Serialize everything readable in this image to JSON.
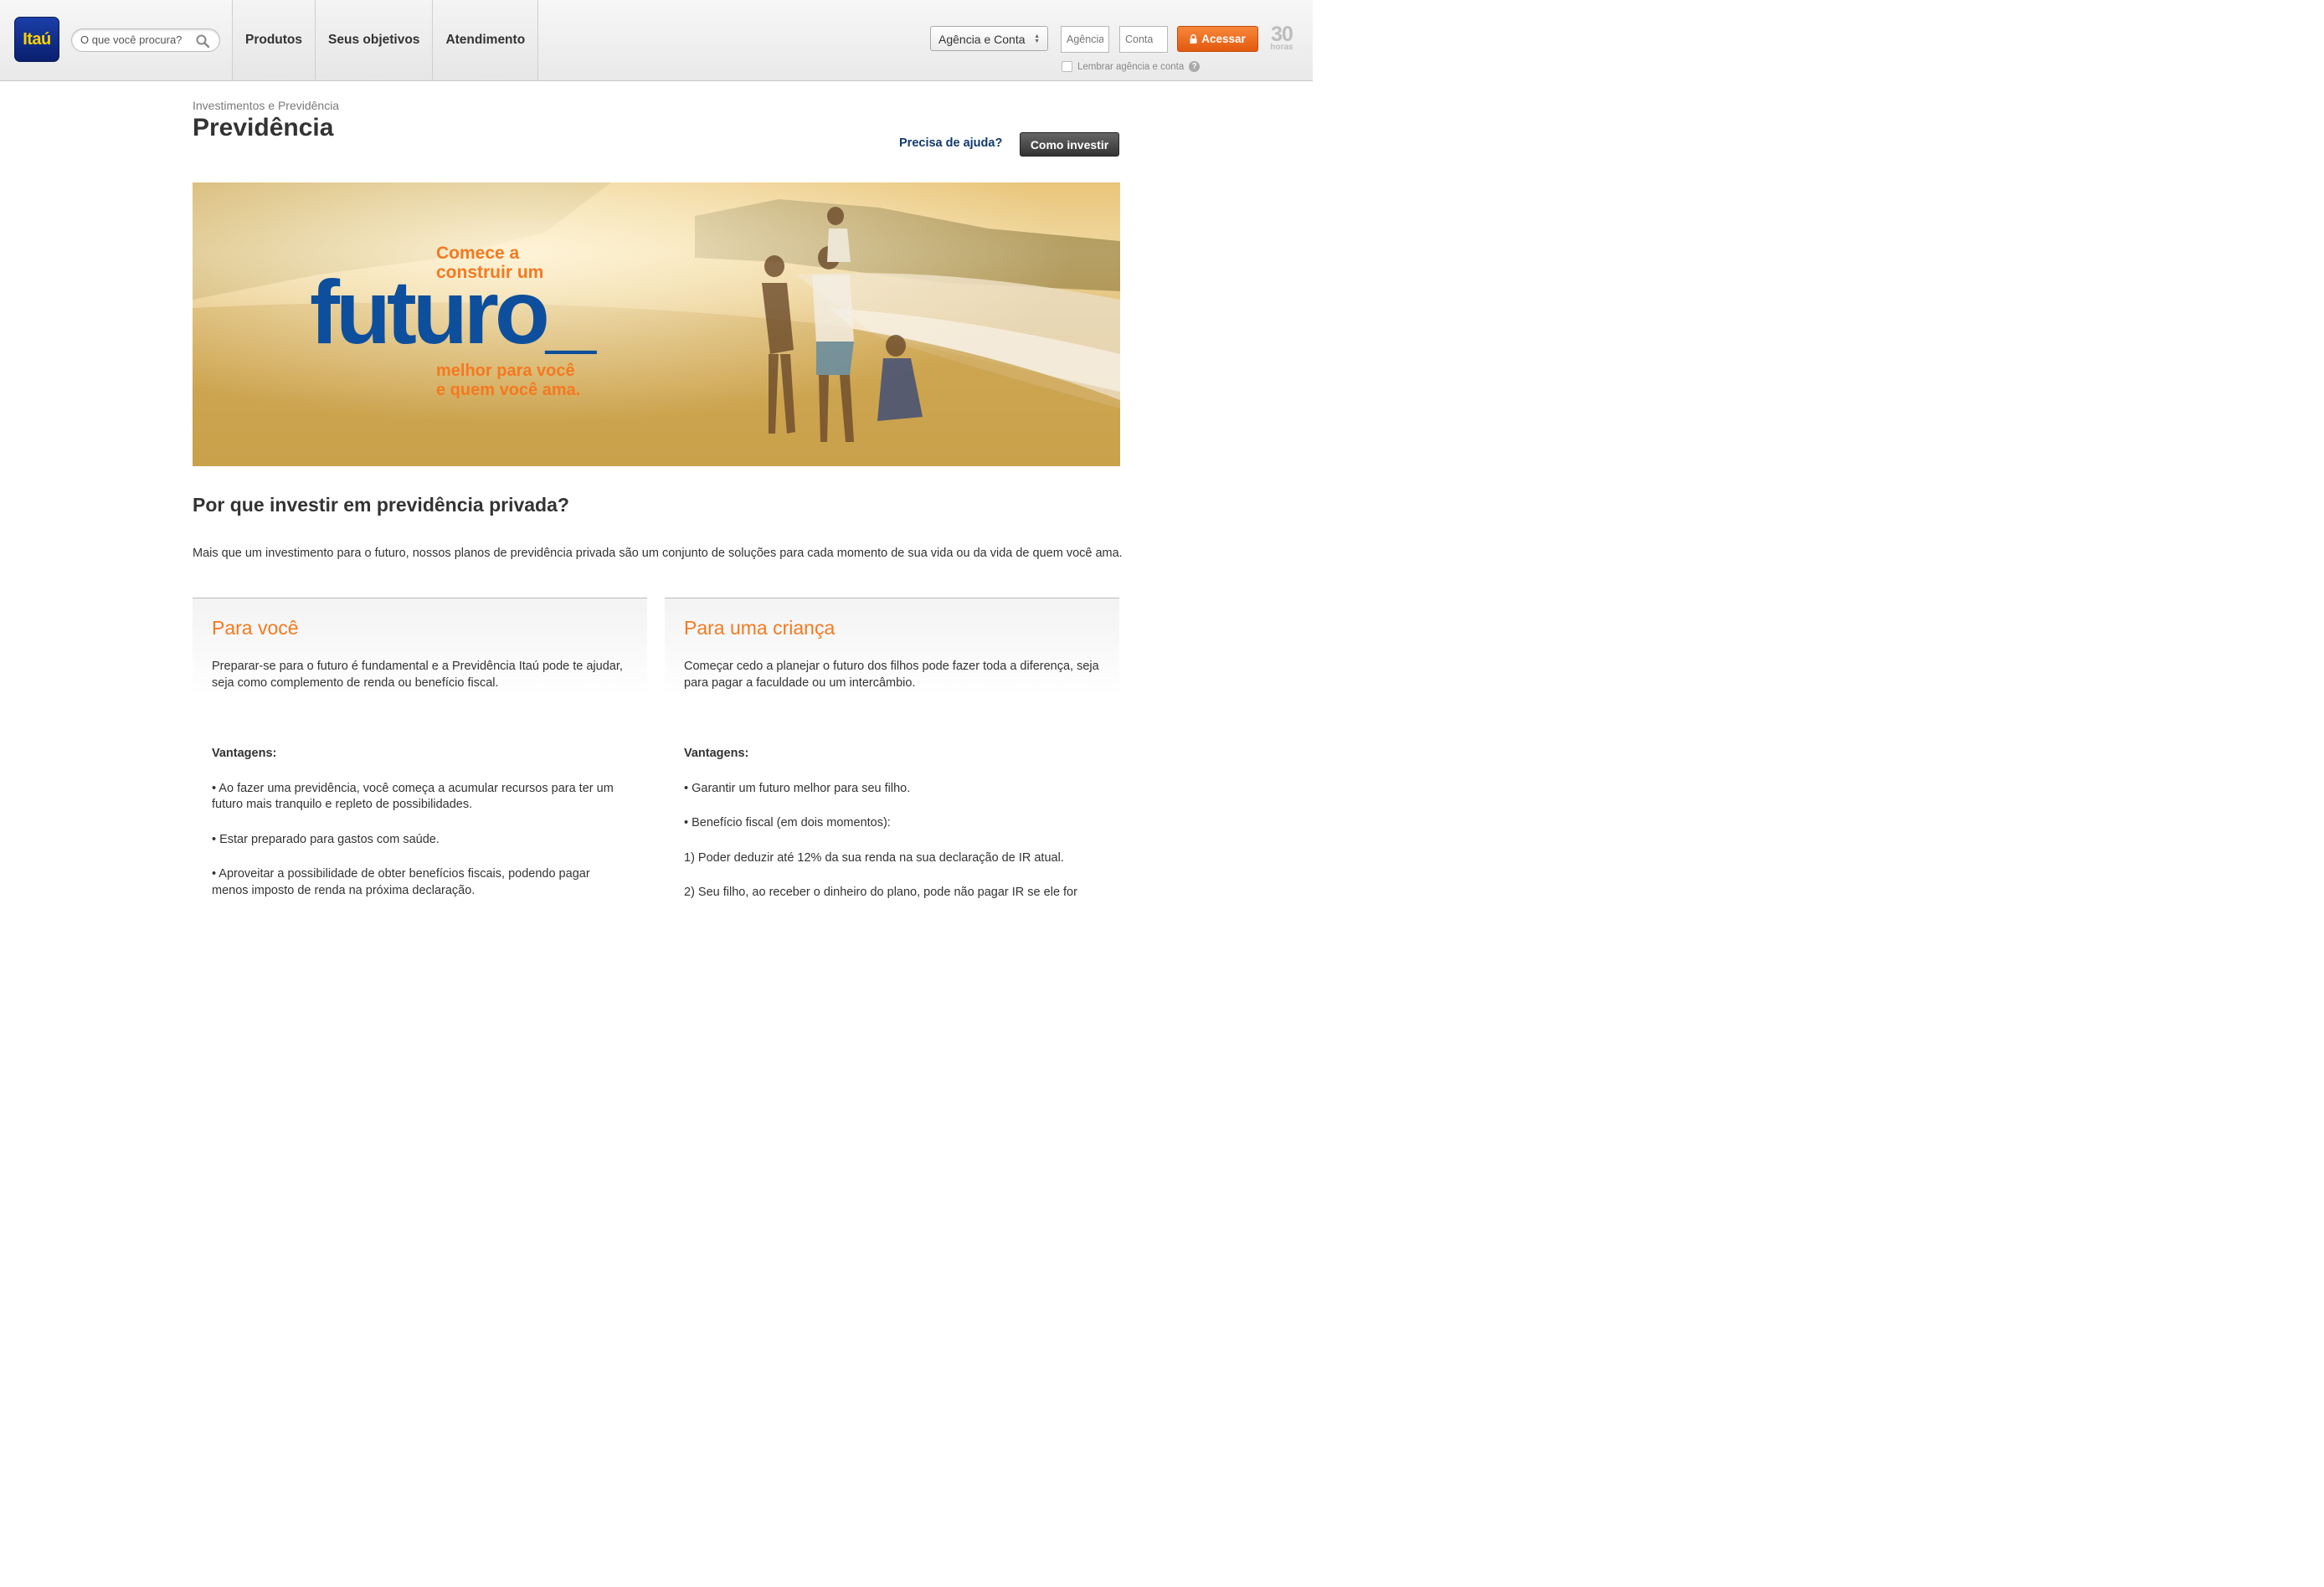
{
  "header": {
    "logo_text": "Itaú",
    "search_placeholder": "O que você procura?",
    "nav": [
      "Produtos",
      "Seus objetivos",
      "Atendimento"
    ],
    "login_select": "Agência e Conta",
    "agencia_placeholder": "Agência",
    "conta_placeholder": "Conta",
    "access_button": "Acessar",
    "remember_label": "Lembrar agência e conta",
    "help_mark": "?",
    "badge_number": "30",
    "badge_label": "horas"
  },
  "page": {
    "breadcrumb": "Investimentos e Previdência",
    "title": "Previdência",
    "help_link": "Precisa de ajuda?",
    "invest_button": "Como investir"
  },
  "banner": {
    "line1": "Comece a",
    "line2": "construir um",
    "big": "futuro_",
    "line3": "melhor para você",
    "line4": "e quem você ama."
  },
  "section": {
    "title": "Por que investir em previdência privada?",
    "intro": "Mais que um investimento para o futuro, nossos planos de previdência privada são um conjunto de soluções para cada momento de sua vida ou da vida de quem você ama."
  },
  "cards": [
    {
      "title": "Para você",
      "desc": "Preparar-se para o futuro é fundamental e a Previdência Itaú pode te ajudar, seja como complemento de renda ou benefício fiscal.",
      "adv_label": "Vantagens:",
      "items": [
        "• Ao fazer uma previdência, você começa a acumular recursos para ter um futuro mais tranquilo e repleto de possibilidades.",
        "• Estar preparado para gastos com saúde.",
        "• Aproveitar a possibilidade de obter benefícios fiscais, podendo pagar menos imposto de renda na próxima declaração."
      ]
    },
    {
      "title": "Para uma criança",
      "desc": "Começar cedo a planejar o futuro dos filhos pode fazer toda a diferença, seja para pagar a faculdade ou um intercâmbio.",
      "adv_label": "Vantagens:",
      "items": [
        "• Garantir um futuro melhor para seu filho.",
        "• Benefício fiscal (em dois momentos):",
        "1) Poder deduzir até 12% da sua renda na sua declaração de IR atual.",
        "2) Seu filho, ao receber o dinheiro do plano, pode não pagar IR se ele for"
      ]
    }
  ],
  "colors": {
    "accent_orange": "#f47920",
    "brand_blue": "#123a6c",
    "logo_yellow": "#ffd200"
  }
}
